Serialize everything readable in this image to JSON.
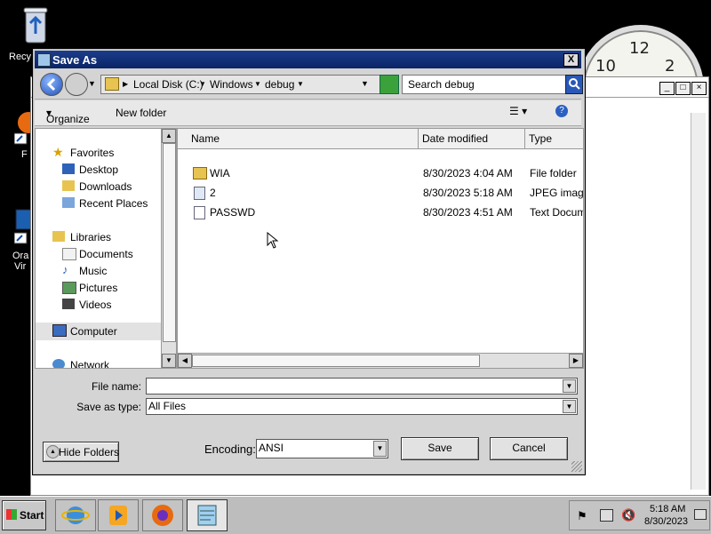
{
  "desktop": {
    "recycle_label": "Recy",
    "firefox_label": "F",
    "oracle_label_1": "Ora",
    "oracle_label_2": "Vir",
    "clock_numbers": [
      "10",
      "12",
      "2"
    ]
  },
  "dialog": {
    "title": "Save As",
    "close_label": "X",
    "breadcrumb": [
      "Local Disk (C:)",
      "Windows",
      "debug"
    ],
    "search_placeholder": "Search debug",
    "toolbar": {
      "organize_label": "Organize",
      "new_folder_label": "New folder"
    },
    "nav": {
      "favorites_header": "Favorites",
      "favorites": [
        "Desktop",
        "Downloads",
        "Recent Places"
      ],
      "libraries_header": "Libraries",
      "libraries": [
        "Documents",
        "Music",
        "Pictures",
        "Videos"
      ],
      "computer": "Computer",
      "network": "Network"
    },
    "columns": [
      "Name",
      "Date modified",
      "Type"
    ],
    "files": [
      {
        "name": "WIA",
        "date": "8/30/2023 4:04 AM",
        "type": "File folder",
        "icon": "folder-icon"
      },
      {
        "name": "2",
        "date": "8/30/2023 5:18 AM",
        "type": "JPEG image",
        "icon": "image-file-icon"
      },
      {
        "name": "PASSWD",
        "date": "8/30/2023 4:51 AM",
        "type": "Text Docume",
        "icon": "text-file-icon"
      }
    ],
    "file_name_label": "File name:",
    "file_name_value": "",
    "save_as_type_label": "Save as type:",
    "save_as_type_value": "All Files",
    "hide_folders_label": "Hide Folders",
    "encoding_label": "Encoding:",
    "encoding_value": "ANSI",
    "save_label": "Save",
    "cancel_label": "Cancel"
  },
  "taskbar": {
    "start_label": "Start",
    "time": "5:18 AM",
    "date": "8/30/2023"
  },
  "colors": {
    "title_bar": "#0a2466",
    "taskbar": "#bdbdbd",
    "dialog_bg": "#d4d4d4"
  }
}
